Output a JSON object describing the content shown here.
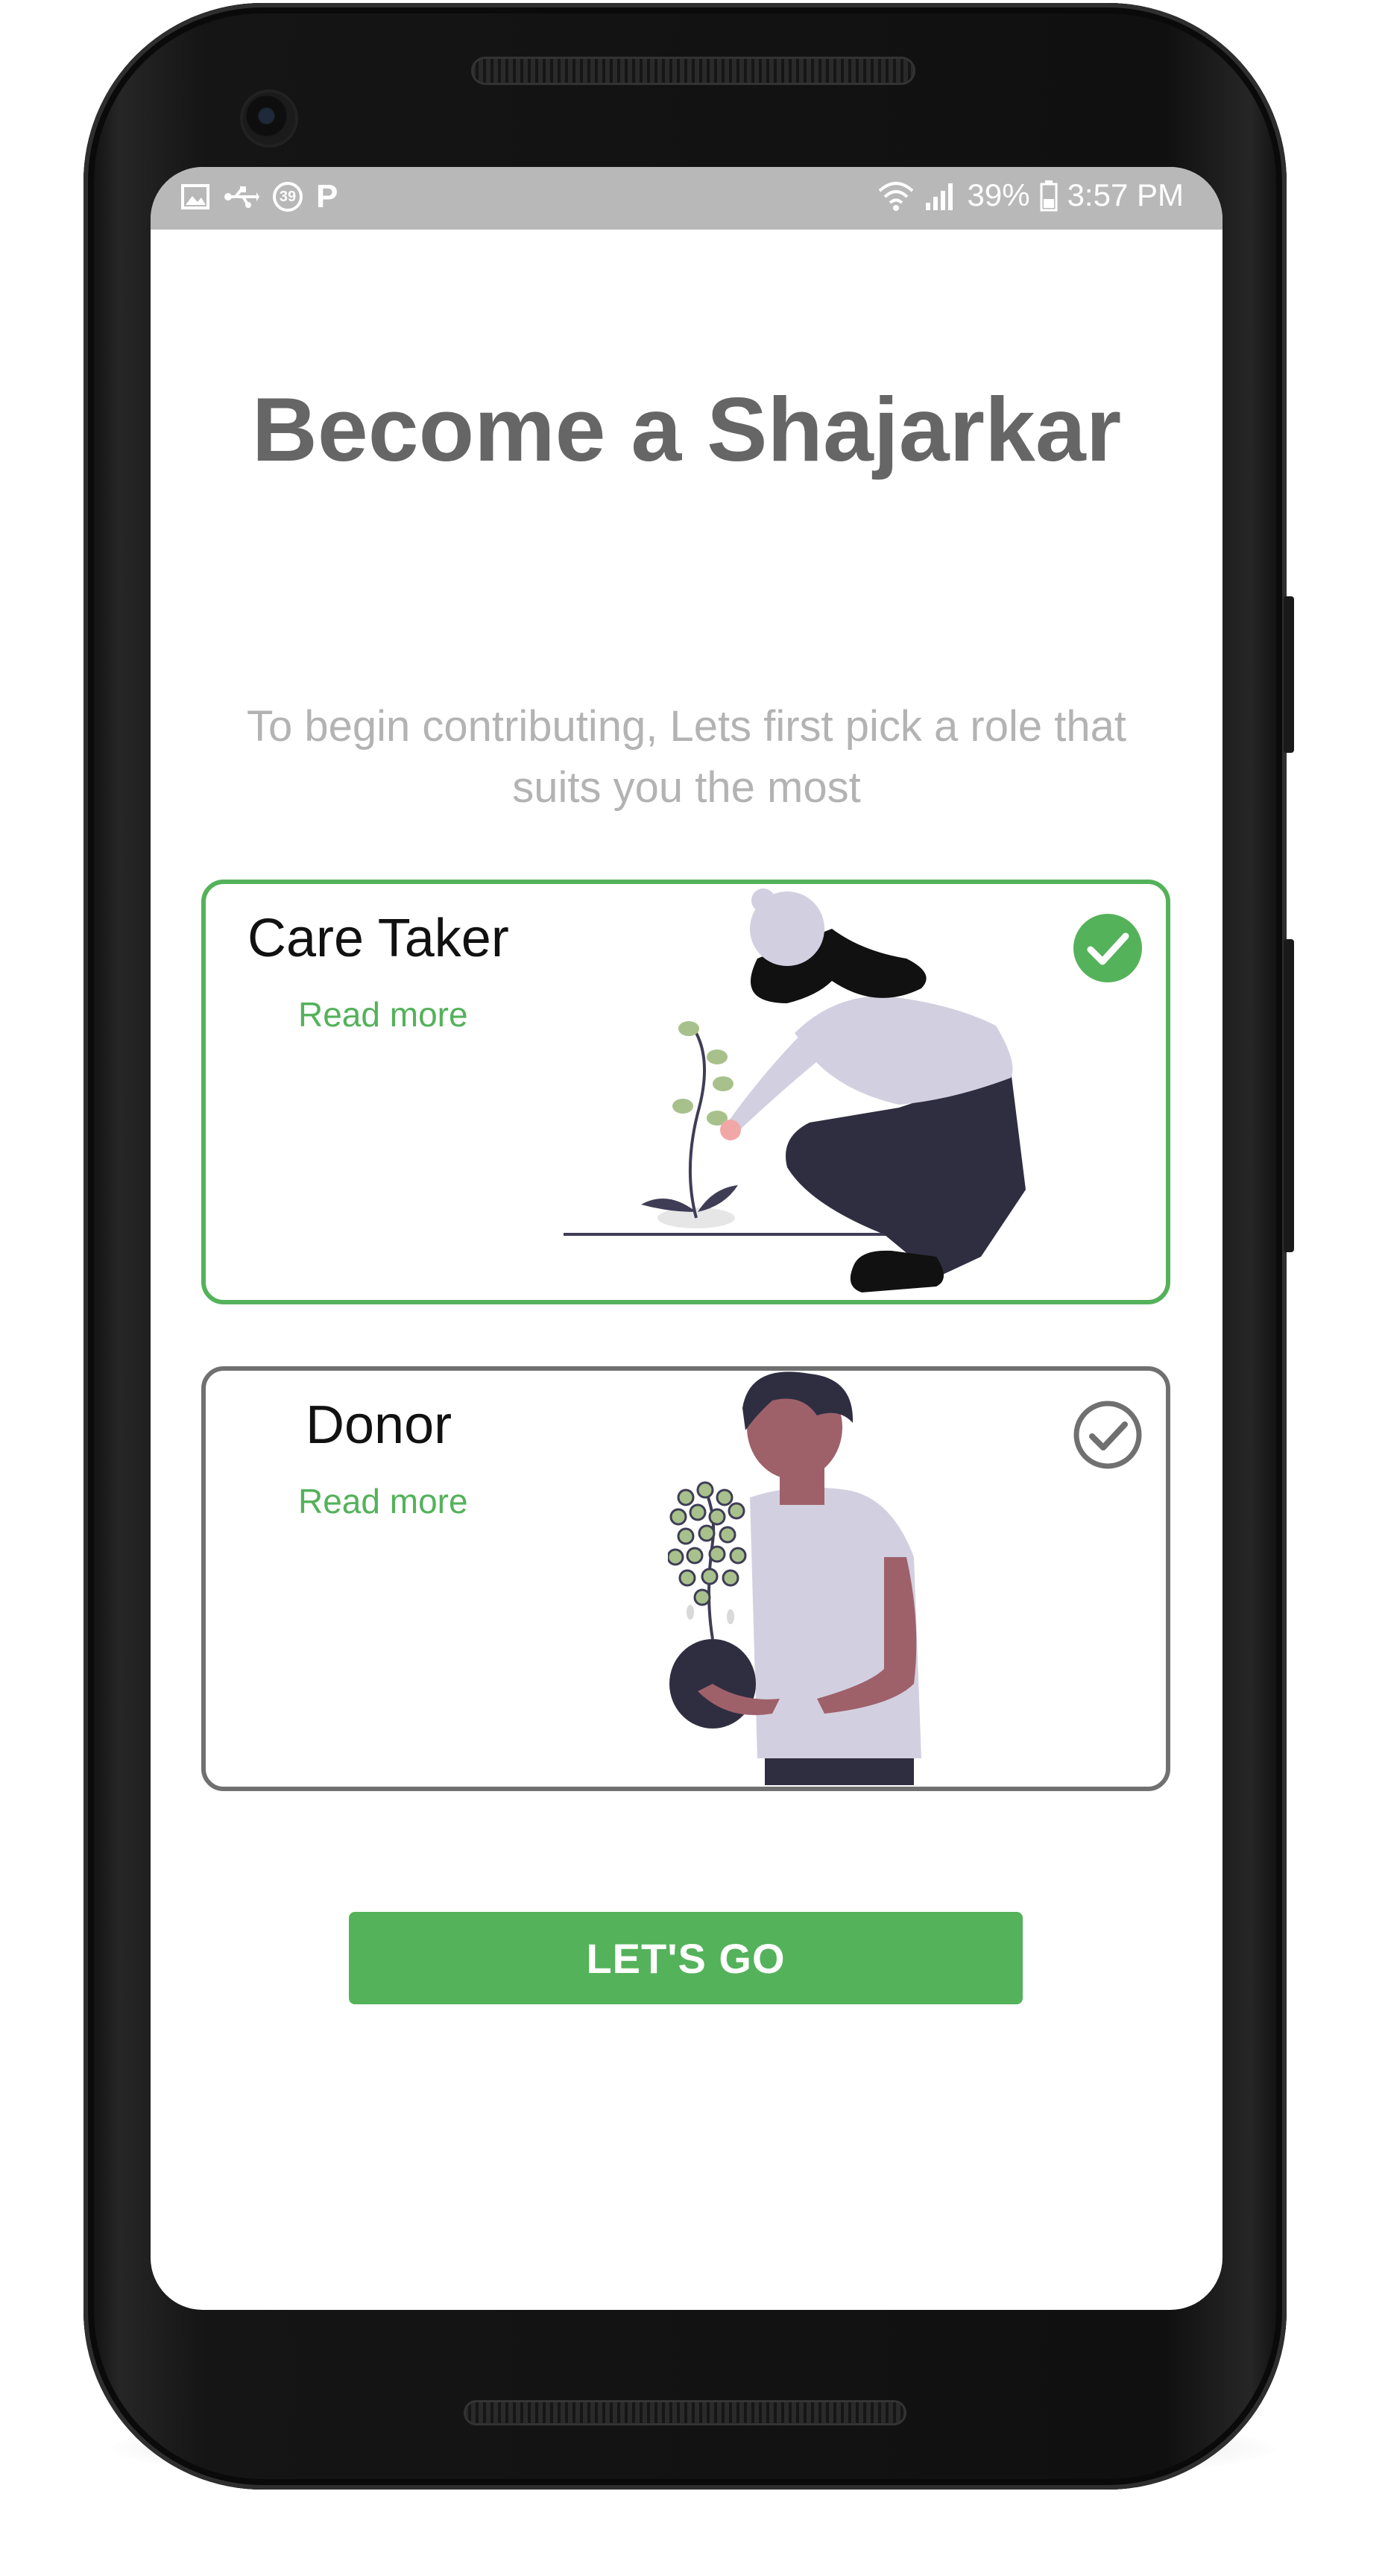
{
  "status_bar": {
    "notification_count": "39",
    "parking_letter": "P",
    "battery": "39%",
    "time": "3:57 PM"
  },
  "onboarding": {
    "title": "Become a Shajarkar",
    "subtitle": "To begin contributing, Lets first pick a role that suits you the most",
    "roles": [
      {
        "name": "Care Taker",
        "read_more": "Read more",
        "selected": true
      },
      {
        "name": "Donor",
        "read_more": "Read more",
        "selected": false
      }
    ],
    "cta_label": "LET'S GO"
  },
  "colors": {
    "accent_green": "#54b25a",
    "title_gray": "#666666",
    "subtitle_gray": "#b3b3b3",
    "unselected_border": "#707070",
    "status_bar_bg": "#b8b8b8"
  },
  "icons": {
    "status_left": [
      "image-icon",
      "usb-icon",
      "notification-count-badge",
      "parking-icon"
    ],
    "status_right": [
      "wifi-icon",
      "signal-icon",
      "battery-icon"
    ],
    "card_selected": "check-circle-filled-icon",
    "card_unselected": "check-circle-outline-icon"
  }
}
